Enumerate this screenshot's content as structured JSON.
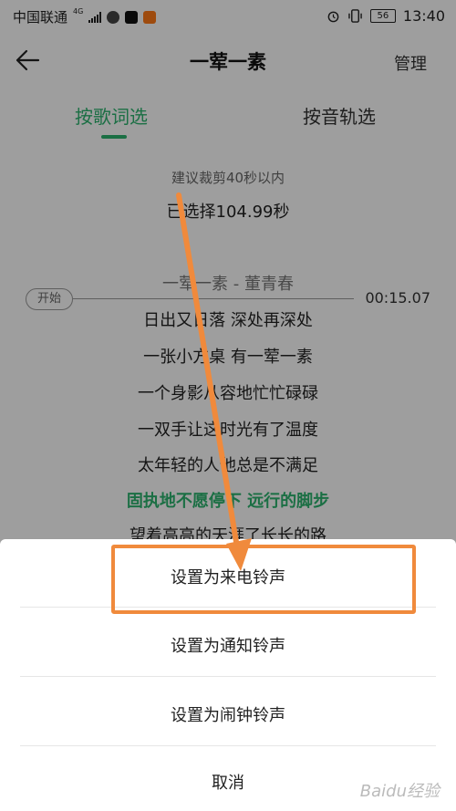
{
  "status_bar": {
    "carrier": "中国联通",
    "network": "4G",
    "battery": "56",
    "time": "13:40"
  },
  "header": {
    "back_icon": "back-arrow-icon",
    "title": "一荤一素",
    "manage": "管理"
  },
  "tabs": [
    {
      "label": "按歌词选",
      "active": true
    },
    {
      "label": "按音轨选",
      "active": false
    }
  ],
  "trim": {
    "hint": "建议裁剪40秒以内",
    "selected": "已选择104.99秒"
  },
  "timeline": {
    "start_label": "开始",
    "time": "00:15.07"
  },
  "lyrics": [
    {
      "text": "一荤一素 - 董青春",
      "style": "song"
    },
    {
      "text": "日出又日落 深处再深处",
      "style": "normal"
    },
    {
      "text": "一张小方桌 有一荤一素",
      "style": "normal"
    },
    {
      "text": "一个身影从容地忙忙碌碌",
      "style": "normal"
    },
    {
      "text": "一双手让这时光有了温度",
      "style": "normal"
    },
    {
      "text": "太年轻的人他总是不满足",
      "style": "normal"
    },
    {
      "text": "固执地不愿停下 远行的脚步",
      "style": "current"
    },
    {
      "text": "望着高高的天涯了长长的路",
      "style": "normal"
    }
  ],
  "sheet": {
    "options": [
      "设置为来电铃声",
      "设置为通知铃声",
      "设置为闹钟铃声"
    ],
    "cancel": "取消"
  },
  "watermark": "Baidu经验",
  "colors": {
    "accent_green": "#2db36f",
    "annotation_orange": "#f08a3c"
  }
}
